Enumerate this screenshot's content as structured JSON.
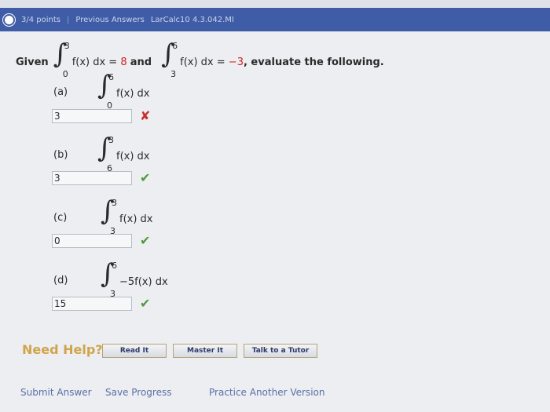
{
  "header": {
    "points": "3/4 points",
    "previous_answers": "Previous Answers",
    "problem_id": "LarCalc10 4.3.042.MI"
  },
  "problem": {
    "given": "Given",
    "int1": {
      "lower": "0",
      "upper": "3",
      "integrand": "f(x) dx =",
      "value": "8"
    },
    "and": "and",
    "int2": {
      "lower": "3",
      "upper": "6",
      "integrand": "f(x) dx =",
      "value": "−3"
    },
    "tail": ", evaluate the following."
  },
  "parts": [
    {
      "label": "(a)",
      "lower": "0",
      "upper": "6",
      "integrand": "f(x) dx",
      "answer": "3",
      "status": "wrong"
    },
    {
      "label": "(b)",
      "lower": "6",
      "upper": "3",
      "integrand": "f(x) dx",
      "answer": "3",
      "status": "correct"
    },
    {
      "label": "(c)",
      "lower": "3",
      "upper": "3",
      "integrand": "f(x) dx",
      "answer": "0",
      "status": "correct"
    },
    {
      "label": "(d)",
      "lower": "3",
      "upper": "6",
      "integrand": "−5f(x) dx",
      "answer": "15",
      "status": "correct"
    }
  ],
  "help": {
    "title": "Need Help?",
    "read": "Read It",
    "master": "Master It",
    "tutor": "Talk to a Tutor"
  },
  "footer": {
    "submit": "Submit Answer",
    "save": "Save Progress",
    "practice": "Practice Another Version"
  },
  "icons": {
    "wrong": "cross-icon",
    "correct": "checkmark-icon"
  },
  "colors": {
    "header": "#3f5ca6",
    "wrong": "#c8302e",
    "correct": "#4f9a3a",
    "highlight": "#d02020"
  }
}
